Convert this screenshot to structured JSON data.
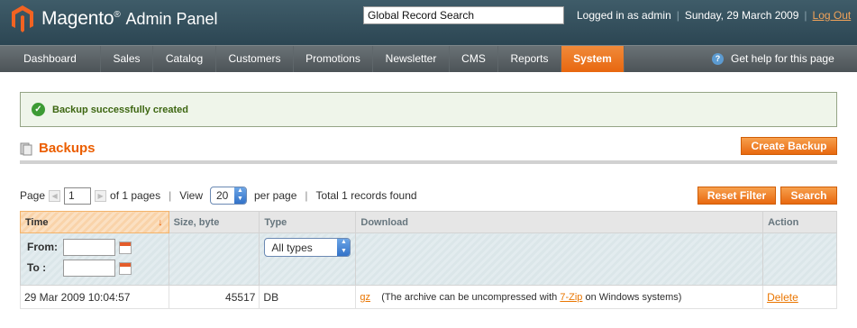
{
  "header": {
    "logo_text": "Magento",
    "logo_trademark": "®",
    "logo_subtitle": "Admin Panel",
    "global_search_value": "Global Record Search",
    "logged_in_text": "Logged in as admin",
    "date_text": "Sunday, 29 March 2009",
    "logout_label": "Log Out"
  },
  "nav": {
    "items": [
      {
        "label": "Dashboard"
      },
      {
        "label": "Sales"
      },
      {
        "label": "Catalog"
      },
      {
        "label": "Customers"
      },
      {
        "label": "Promotions"
      },
      {
        "label": "Newsletter"
      },
      {
        "label": "CMS"
      },
      {
        "label": "Reports"
      },
      {
        "label": "System",
        "active": true
      }
    ],
    "help_label": "Get help for this page"
  },
  "message": {
    "text": "Backup successfully created"
  },
  "page": {
    "title": "Backups",
    "create_button": "Create Backup"
  },
  "pager": {
    "page_label": "Page",
    "page_value": "1",
    "of_pages": "of 1 pages",
    "view_label": "View",
    "view_value": "20",
    "per_page": "per page",
    "total": "Total 1 records found",
    "reset_button": "Reset Filter",
    "search_button": "Search"
  },
  "grid": {
    "columns": {
      "time": "Time",
      "size": "Size, byte",
      "type": "Type",
      "download": "Download",
      "action": "Action"
    },
    "filter": {
      "from_label": "From:",
      "to_label": "To :",
      "type_value": "All types"
    },
    "rows": [
      {
        "time": "29 Mar 2009 10:04:57",
        "size": "45517",
        "type": "DB",
        "download_link": "gz",
        "download_note_before": "(The archive can be uncompressed with",
        "download_tool_link": "7-Zip",
        "download_note_after": "on Windows systems)",
        "action": "Delete"
      }
    ]
  },
  "colors": {
    "accent": "#eb5e00",
    "header_bg": "#2c4653",
    "nav_bg": "#4c5357",
    "active_tab": "#e8670f",
    "success_bg": "#eff5ea",
    "success_text": "#3d6611"
  }
}
